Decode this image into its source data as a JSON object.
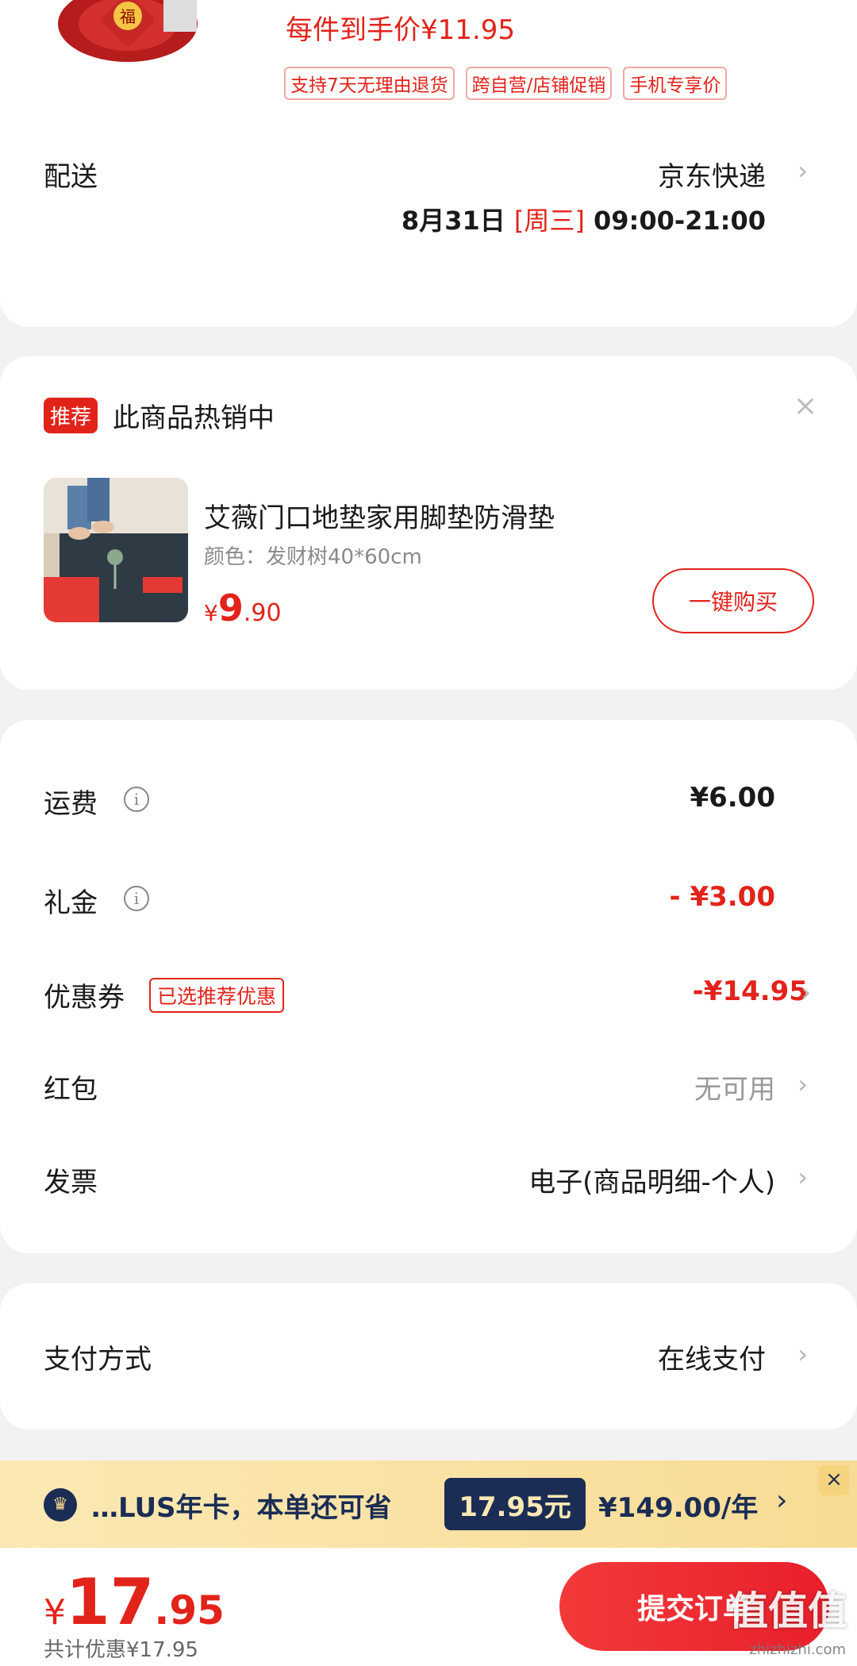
{
  "product": {
    "unit_price": "每件到手价¥11.95",
    "tags": [
      "支持7天无理由退货",
      "跨自营/店铺促销",
      "手机专享价"
    ]
  },
  "delivery": {
    "label": "配送",
    "carrier": "京东快递",
    "date": "8月31日",
    "weekday": "[周三]",
    "time": "09:00-21:00"
  },
  "recommend": {
    "badge": "推荐",
    "title": "此商品热销中",
    "close": "×",
    "name": "艾薇门口地垫家用脚垫防滑垫",
    "spec": "颜色：发财树40*60cm",
    "price_currency": "¥",
    "price_int": "9",
    "price_dec": ".90",
    "buy_label": "一键购买"
  },
  "fees": {
    "shipping_label": "运费",
    "shipping_value": "¥6.00",
    "gift_label": "礼金",
    "gift_value": "- ¥3.00",
    "coupon_label": "优惠券",
    "coupon_tag": "已选推荐优惠",
    "coupon_value": "-¥14.95",
    "redpacket_label": "红包",
    "redpacket_value": "无可用",
    "invoice_label": "发票",
    "invoice_value": "电子(商品明细-个人)"
  },
  "payment": {
    "label": "支付方式",
    "value": "在线支付"
  },
  "plus": {
    "text": "…LUS年卡，本单还可省",
    "save": "17.95元",
    "price": "¥149.00/年",
    "close": "×"
  },
  "bottom": {
    "currency": "¥",
    "total_int": "17",
    "total_dec": ".95",
    "discount": "共计优惠¥17.95",
    "submit": "提交订单"
  },
  "watermark": {
    "main": "值值值",
    "url": "zhizhizhi.com"
  },
  "colors": {
    "accent": "#e2231a",
    "plus_navy": "#1b2d55",
    "plus_gold": "#fbe8b4"
  }
}
